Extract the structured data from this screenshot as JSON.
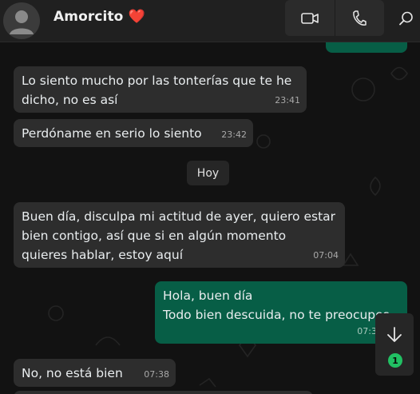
{
  "contact": {
    "name": "Amorcito ❤️",
    "avatar_icon": "default-avatar-icon"
  },
  "header": {
    "video_call_icon": "video-call-icon",
    "voice_call_icon": "phone-icon",
    "search_icon": "search-icon"
  },
  "date_separator": "Hoy",
  "messages": [
    {
      "direction": "in",
      "lines": [
        "Lo siento mucho por las tonterías que te he",
        "dicho, no es así"
      ],
      "time": "23:41"
    },
    {
      "direction": "in",
      "lines": [
        "Perdóname en serio lo siento"
      ],
      "time": "23:42"
    },
    {
      "direction": "in",
      "lines": [
        "Buen día, disculpa mi actitud de ayer, quiero estar",
        "bien contigo, así que si en algún momento",
        "quieres hablar, estoy aquí"
      ],
      "time": "07:04"
    },
    {
      "direction": "out",
      "lines": [
        "Hola, buen día",
        "Todo bien descuida, no te preocupes"
      ],
      "time": "07:3"
    },
    {
      "direction": "in",
      "lines": [
        "No, no está bien"
      ],
      "time": "07:38"
    }
  ],
  "scroll_to_bottom": {
    "icon": "arrow-down-icon",
    "unread_count": "1"
  },
  "colors": {
    "incoming_bubble": "#2d2d2d",
    "outgoing_bubble": "#075e46",
    "unread_badge": "#21c063",
    "header": "#202020"
  }
}
